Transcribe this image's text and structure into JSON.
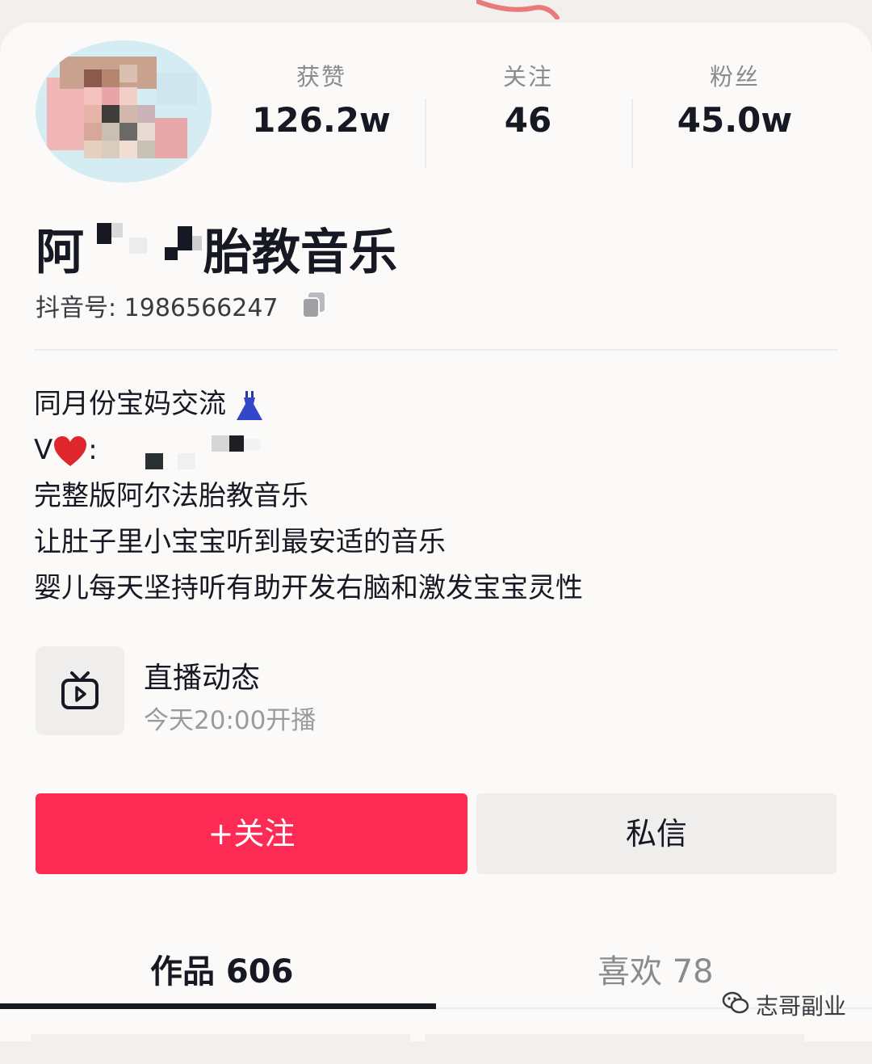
{
  "stats": [
    {
      "label": "获赞",
      "value": "126.2w"
    },
    {
      "label": "关注",
      "value": "46"
    },
    {
      "label": "粉丝",
      "value": "45.0w"
    }
  ],
  "profile": {
    "name_start": "阿",
    "name_end": "胎教音乐",
    "douyin_id": "抖音号: 1986566247"
  },
  "bio": {
    "line1": "同月份宝妈交流",
    "line1_emoji": "dress-icon",
    "line2_prefix": "V",
    "line2_emoji": "red-heart-icon",
    "line2_colon": ":",
    "line3": "完整版阿尔法胎教音乐",
    "line4": "让肚子里小宝宝听到最安适的音乐",
    "line5": "婴儿每天坚持听有助开发右脑和激发宝宝灵性"
  },
  "live": {
    "title": "直播动态",
    "subtitle": "今天20:00开播"
  },
  "buttons": {
    "follow": "+关注",
    "message": "私信"
  },
  "tabs": {
    "works": "作品 606",
    "likes": "喜欢 78"
  },
  "watermark": "志哥副业",
  "colors": {
    "accent": "#fe2c55",
    "text": "#161823",
    "muted": "#8a8b91"
  }
}
